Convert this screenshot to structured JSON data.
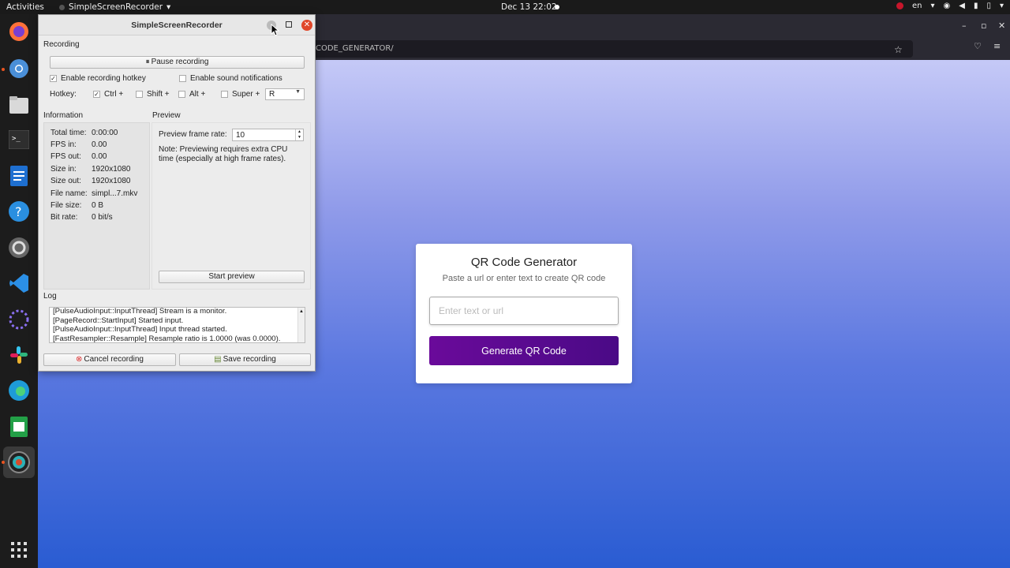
{
  "topbar": {
    "activities": "Activities",
    "app_name": "SimpleScreenRecorder",
    "clock": "Dec 13  22:02",
    "lang": "en"
  },
  "browser": {
    "url_fragment": "CODE_GENERATOR/"
  },
  "qr": {
    "title": "QR Code Generator",
    "subtitle": "Paste a url or enter text to create QR code",
    "input_placeholder": "Enter text or url",
    "button_label": "Generate QR Code"
  },
  "ssr": {
    "title": "SimpleScreenRecorder",
    "recording_label": "Recording",
    "pause_button": "Pause recording",
    "enable_hotkey": "Enable recording hotkey",
    "enable_sound": "Enable sound notifications",
    "hotkey_label": "Hotkey:",
    "hotkey_ctrl": "Ctrl +",
    "hotkey_shift": "Shift +",
    "hotkey_alt": "Alt +",
    "hotkey_super": "Super +",
    "hotkey_key": "R",
    "information_label": "Information",
    "info": [
      {
        "k": "Total time:",
        "v": "0:00:00"
      },
      {
        "k": "FPS in:",
        "v": "0.00"
      },
      {
        "k": "FPS out:",
        "v": "0.00"
      },
      {
        "k": "Size in:",
        "v": "1920x1080"
      },
      {
        "k": "Size out:",
        "v": "1920x1080"
      },
      {
        "k": "File name:",
        "v": "simpl...7.mkv"
      },
      {
        "k": "File size:",
        "v": "0 B"
      },
      {
        "k": "Bit rate:",
        "v": "0 bit/s"
      }
    ],
    "preview_label": "Preview",
    "preview_rate_label": "Preview frame rate:",
    "preview_rate_value": "10",
    "preview_note": "Note: Previewing requires extra CPU time (especially at high frame rates).",
    "start_preview": "Start preview",
    "log_label": "Log",
    "log_lines": [
      "[PulseAudioInput::InputThread] Stream is a monitor.",
      "[PageRecord::StartInput] Started input.",
      "[PulseAudioInput::InputThread] Input thread started.",
      "[FastResampler::Resample] Resample ratio is 1.0000 (was 0.0000)."
    ],
    "cancel_button": "Cancel recording",
    "save_button": "Save recording"
  }
}
